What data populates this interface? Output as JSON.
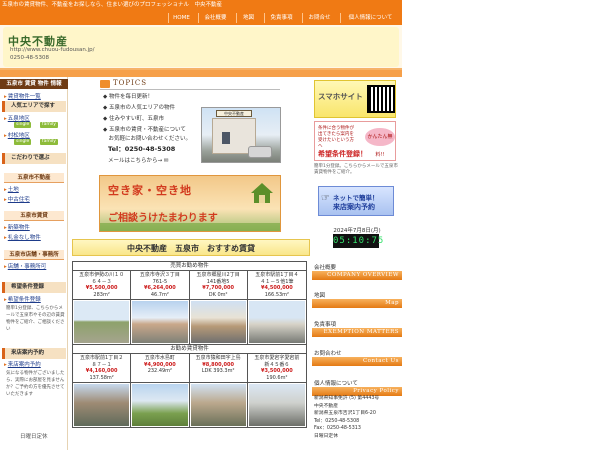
{
  "topbar": {
    "text": "五泉市の賃貸物件、不動産をお探しなら、住まい選びのプロフェッショナル　中央不動産"
  },
  "nav": {
    "items": [
      {
        "label": "HOME",
        "name": "nav-home"
      },
      {
        "label": "会社概要",
        "name": "nav-company"
      },
      {
        "label": "地図",
        "name": "nav-map"
      },
      {
        "label": "免責事項",
        "name": "nav-disclaimer"
      },
      {
        "label": "お問合せ",
        "name": "nav-contact"
      },
      {
        "label": "個人情報について",
        "name": "nav-privacy"
      }
    ]
  },
  "header": {
    "title": "中央不動産",
    "url": "http://www.chuou-fudousan.jp/",
    "tel": "0250-48-5308"
  },
  "sidebar": {
    "head1": "五泉市 賃貸 物件 情報",
    "link_list": "賃貸物件一覧",
    "band_popular": "人気エリアで探す",
    "area1": "五泉地区",
    "area2": "村松地区",
    "tag_single": "single",
    "tag_family": "family",
    "band_kodawari": "こだわりで選ぶ",
    "head_realestate": "五泉市不動産",
    "link_land": "土地",
    "link_used_house": "中古住宅",
    "head_rental": "五泉市賃貸",
    "link_new": "新築物件",
    "link_no_key": "礼金なし物件",
    "head_store": "五泉市店舗・事務所",
    "link_store": "店舗・事務所可",
    "band_wish": "希望条件登録",
    "link_wish": "希望条件登録",
    "wish_text": "簡単1分登録、こちらからメールで五泉市やその辺の賃貸物件をご紹介、ご相談ください",
    "band_guide": "来店案内予約",
    "link_guide": "来店案内予約",
    "guide_text": "気になる物件がございましたら、実際にお部屋を見ませんか？ご予約の方を優先させていただきます",
    "footer_label": "日曜日定休"
  },
  "topics": {
    "title": "TOPICS",
    "items": [
      "◆ 物件を毎日更新！",
      "◆ 五泉市の人気エリアの物件",
      "◆ 住みやすい町、五泉市",
      "◆ 五泉市の賃貸・不動産について",
      "　お気軽にお問い合わせください。"
    ],
    "tel": "Tel：0250-48-5308",
    "mail": "メールはこちらから→",
    "sign": "中央不動産"
  },
  "banner": {
    "line1": "空き家・空き地",
    "line2": "ご相談うけたまわります"
  },
  "section": {
    "title": "中央不動産　五泉市　おすすめ賃貸"
  },
  "listings": {
    "group1_title": "売買お勧め物件",
    "group2_title": "お勧め賃貸物件",
    "group1": [
      {
        "addr1": "五泉市伊勢の川１０",
        "addr2": "６４－３",
        "price": "¥5,500,000",
        "size": "283m²"
      },
      {
        "addr1": "五泉市寺沢３丁目",
        "addr2": "761-5",
        "price": "¥6,264,000",
        "size": "46.7m²"
      },
      {
        "addr1": "五泉市郷屋川2丁目",
        "addr2": "141番地5",
        "price": "¥7,700,000",
        "size": "DK 0m²"
      },
      {
        "addr1": "五泉市駅前1丁目４",
        "addr2": "４１－５他1筆",
        "price": "¥4,500,000",
        "size": "166.53m²"
      }
    ],
    "group2": [
      {
        "addr1": "五泉市駅前1丁目２",
        "addr2": "８７－１",
        "price": "¥4,160,000",
        "size": "137.58m²"
      },
      {
        "addr1": "五泉市水島町",
        "addr2": "",
        "price": "¥4,900,000",
        "size": "232.49m²"
      },
      {
        "addr1": "五泉市猿和田字上島",
        "addr2": "",
        "price": "¥8,800,000",
        "size": "LDK 393.3m²"
      },
      {
        "addr1": "五泉市愛宕字愛宕前",
        "addr2": "新４５番６",
        "price": "¥3,500,000",
        "size": "190.6m²"
      }
    ]
  },
  "right": {
    "qr_text": "スマホサイト",
    "wish_small": "条件に合う物件が出てきたら案内を受けたいという方へ",
    "wish_pig": "かんたん無料!!",
    "wish_big": "希望条件登録！",
    "wish_caption": "簡単1分登録。こちらからメールで五泉市賃貸物件をご紹介。",
    "net1": "ネットで簡単！",
    "net2": "来店案内予約",
    "date": "2024年7月8日(月)",
    "clock": "05:10:75",
    "sections": [
      {
        "jp": "会社概要",
        "en": "COMPANY OVERVIEW"
      },
      {
        "jp": "地図",
        "en": "Map"
      },
      {
        "jp": "免責事項",
        "en": "EXEMPTION MATTERS"
      },
      {
        "jp": "お問合わせ",
        "en": "Contact Us"
      },
      {
        "jp": "個人情報について",
        "en": "Privacy Policy"
      }
    ],
    "company": [
      "新潟県知事免許 (5) 第4443号",
      "中央不動産",
      "新潟県五泉市吉沢1丁目6-20",
      "Tel：0250-48-5308",
      "Fax：0250-48-5313",
      "日曜日定休"
    ]
  },
  "colors": {
    "accent": "#f07a14",
    "brown": "#6f3b14",
    "price_red": "#cc1a1a",
    "green": "#8dbb3a"
  }
}
